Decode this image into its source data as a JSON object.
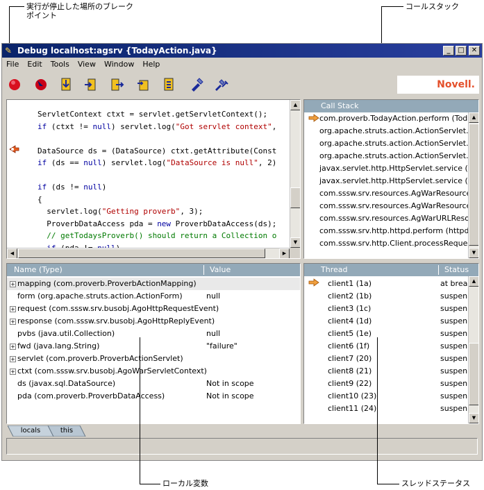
{
  "callouts": {
    "breakpoint_line1": "実行が停止した場所のブレーク",
    "breakpoint_line2": "ポイント",
    "call_stack": "コールスタック",
    "local_variables": "ローカル変数",
    "thread_status": "スレッドステータス"
  },
  "window": {
    "title": "Debug localhost:agsrv {TodayAction.java}",
    "min": "_",
    "max": "□",
    "close": "✕"
  },
  "menu": [
    "File",
    "Edit",
    "Tools",
    "View",
    "Window",
    "Help"
  ],
  "toolbar": {
    "icons": [
      "stop-icon",
      "pause-icon",
      "step-into-icon",
      "step-over-icon",
      "step-out-icon",
      "run-to-cursor-icon",
      "continue-icon",
      "set-breakpoint-icon",
      "clear-breakpoints-icon"
    ],
    "brand": "Novell."
  },
  "code": {
    "lines": [
      {
        "t": "plain",
        "parts": [
          [
            "",
            "ServletContext ctxt = servlet.getServletContext();"
          ]
        ]
      },
      {
        "t": "mixed",
        "parts": [
          [
            "kw",
            "if"
          ],
          [
            "",
            " (ctxt != "
          ],
          [
            "kw",
            "null"
          ],
          [
            "",
            ") servlet.log("
          ],
          [
            "str",
            "\"Got servlet context\""
          ],
          [
            "",
            ","
          ]
        ]
      },
      {
        "t": "blank",
        "parts": [
          [
            "",
            ""
          ]
        ]
      },
      {
        "t": "mixed",
        "parts": [
          [
            "",
            "DataSource ds = (DataSource) ctxt.getAttribute(Const"
          ]
        ]
      },
      {
        "t": "mixed",
        "parts": [
          [
            "kw",
            "if"
          ],
          [
            "",
            " (ds == "
          ],
          [
            "kw",
            "null"
          ],
          [
            "",
            ") servlet.log("
          ],
          [
            "str",
            "\"DataSource is null\""
          ],
          [
            "",
            ", 2)"
          ]
        ]
      },
      {
        "t": "blank",
        "parts": [
          [
            "",
            ""
          ]
        ]
      },
      {
        "t": "mixed",
        "parts": [
          [
            "kw",
            "if"
          ],
          [
            "",
            " (ds != "
          ],
          [
            "kw",
            "null"
          ],
          [
            "",
            ")"
          ]
        ]
      },
      {
        "t": "plain",
        "parts": [
          [
            "",
            "{"
          ]
        ]
      },
      {
        "t": "mixed",
        "parts": [
          [
            "",
            "  servlet.log("
          ],
          [
            "str",
            "\"Getting proverb\""
          ],
          [
            "",
            ", 3);"
          ]
        ]
      },
      {
        "t": "mixed",
        "parts": [
          [
            "",
            "  ProverbDataAccess pda = "
          ],
          [
            "kw",
            "new"
          ],
          [
            "",
            " ProverbDataAccess(ds);"
          ]
        ]
      },
      {
        "t": "comment",
        "parts": [
          [
            "cm",
            "  // getTodaysProverb() should return a Collection o"
          ]
        ]
      },
      {
        "t": "mixed",
        "parts": [
          [
            "",
            "  "
          ],
          [
            "kw",
            "if"
          ],
          [
            "",
            " (pda != "
          ],
          [
            "kw",
            "null"
          ],
          [
            "",
            ")"
          ]
        ]
      }
    ]
  },
  "call_stack": {
    "header": "Call Stack",
    "frames": [
      "com.proverb.TodayAction.perform (TodayA",
      "org.apache.struts.action.ActionServlet.proc",
      "org.apache.struts.action.ActionServlet.proc",
      "org.apache.struts.action.ActionServlet.doGe",
      "javax.servlet.http.HttpServlet.service (HttpS",
      "javax.servlet.http.HttpServlet.service (HttpS",
      "com.sssw.srv.resources.AgWarResource.c",
      "com.sssw.srv.resources.AgWarResource.s",
      "com.sssw.srv.resources.AgWarURLResou",
      "com.sssw.srv.http.httpd.perform (httpd.java",
      "com.sssw.srv.http.Client.processRequest ("
    ]
  },
  "locals": {
    "col_name": "Name (Type)",
    "col_value": "Value",
    "rows": [
      {
        "name": "mapping (com.proverb.ProverbActionMapping)",
        "value": "",
        "expandable": true
      },
      {
        "name": "form (org.apache.struts.action.ActionForm)",
        "value": "null",
        "expandable": false
      },
      {
        "name": "request (com.sssw.srv.busobj.AgoHttpRequestEvent)",
        "value": "",
        "expandable": true
      },
      {
        "name": "response (com.sssw.srv.busobj.AgoHttpReplyEvent)",
        "value": "",
        "expandable": true
      },
      {
        "name": "pvbs (java.util.Collection)",
        "value": "null",
        "expandable": false
      },
      {
        "name": "fwd (java.lang.String)",
        "value": "\"failure\"",
        "expandable": true
      },
      {
        "name": "servlet (com.proverb.ProverbActionServlet)",
        "value": "",
        "expandable": true
      },
      {
        "name": "ctxt (com.sssw.srv.busobj.AgoWarServletContext)",
        "value": "",
        "expandable": true
      },
      {
        "name": "ds (javax.sql.DataSource)",
        "value": "Not in scope",
        "expandable": false
      },
      {
        "name": "pda (com.proverb.ProverbDataAccess)",
        "value": "Not in scope",
        "expandable": false
      }
    ]
  },
  "threads": {
    "col_thread": "Thread",
    "col_status": "Status",
    "rows": [
      {
        "name": "client1 (1a)",
        "status": "at break"
      },
      {
        "name": "client2 (1b)",
        "status": "suspen"
      },
      {
        "name": "client3 (1c)",
        "status": "suspen"
      },
      {
        "name": "client4 (1d)",
        "status": "suspen"
      },
      {
        "name": "client5 (1e)",
        "status": "suspen"
      },
      {
        "name": "client6 (1f)",
        "status": "suspen"
      },
      {
        "name": "client7 (20)",
        "status": "suspen"
      },
      {
        "name": "client8 (21)",
        "status": "suspen"
      },
      {
        "name": "client9 (22)",
        "status": "suspen"
      },
      {
        "name": "client10 (23)",
        "status": "suspen"
      },
      {
        "name": "client11 (24)",
        "status": "suspen"
      }
    ]
  },
  "tabs": [
    "locals",
    "this"
  ]
}
